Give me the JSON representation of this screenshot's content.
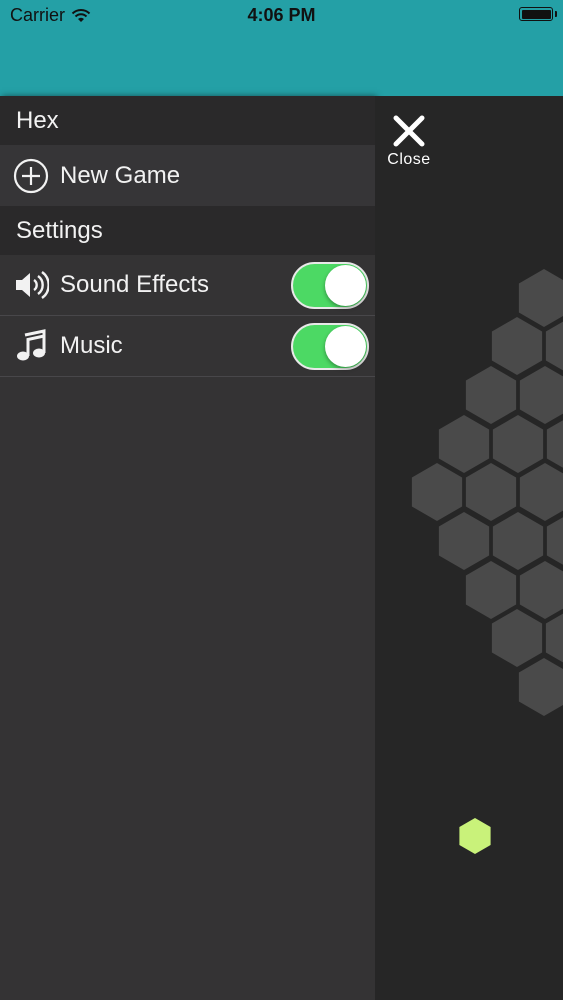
{
  "status_bar": {
    "carrier": "Carrier",
    "time": "4:06 PM"
  },
  "menu": {
    "title": "Hex",
    "new_game_label": "New Game",
    "settings_header": "Settings",
    "settings": [
      {
        "label": "Sound Effects",
        "icon": "speaker-icon",
        "enabled": true
      },
      {
        "label": "Music",
        "icon": "music-note-icon",
        "enabled": true
      }
    ]
  },
  "game": {
    "close_label": "Close",
    "board_color": "#4a4a4a",
    "piece_color": "#c9f27a"
  },
  "colors": {
    "status_bar_bg": "#24a0a6",
    "toggle_on": "#4cd964",
    "menu_bg": "#343334"
  }
}
